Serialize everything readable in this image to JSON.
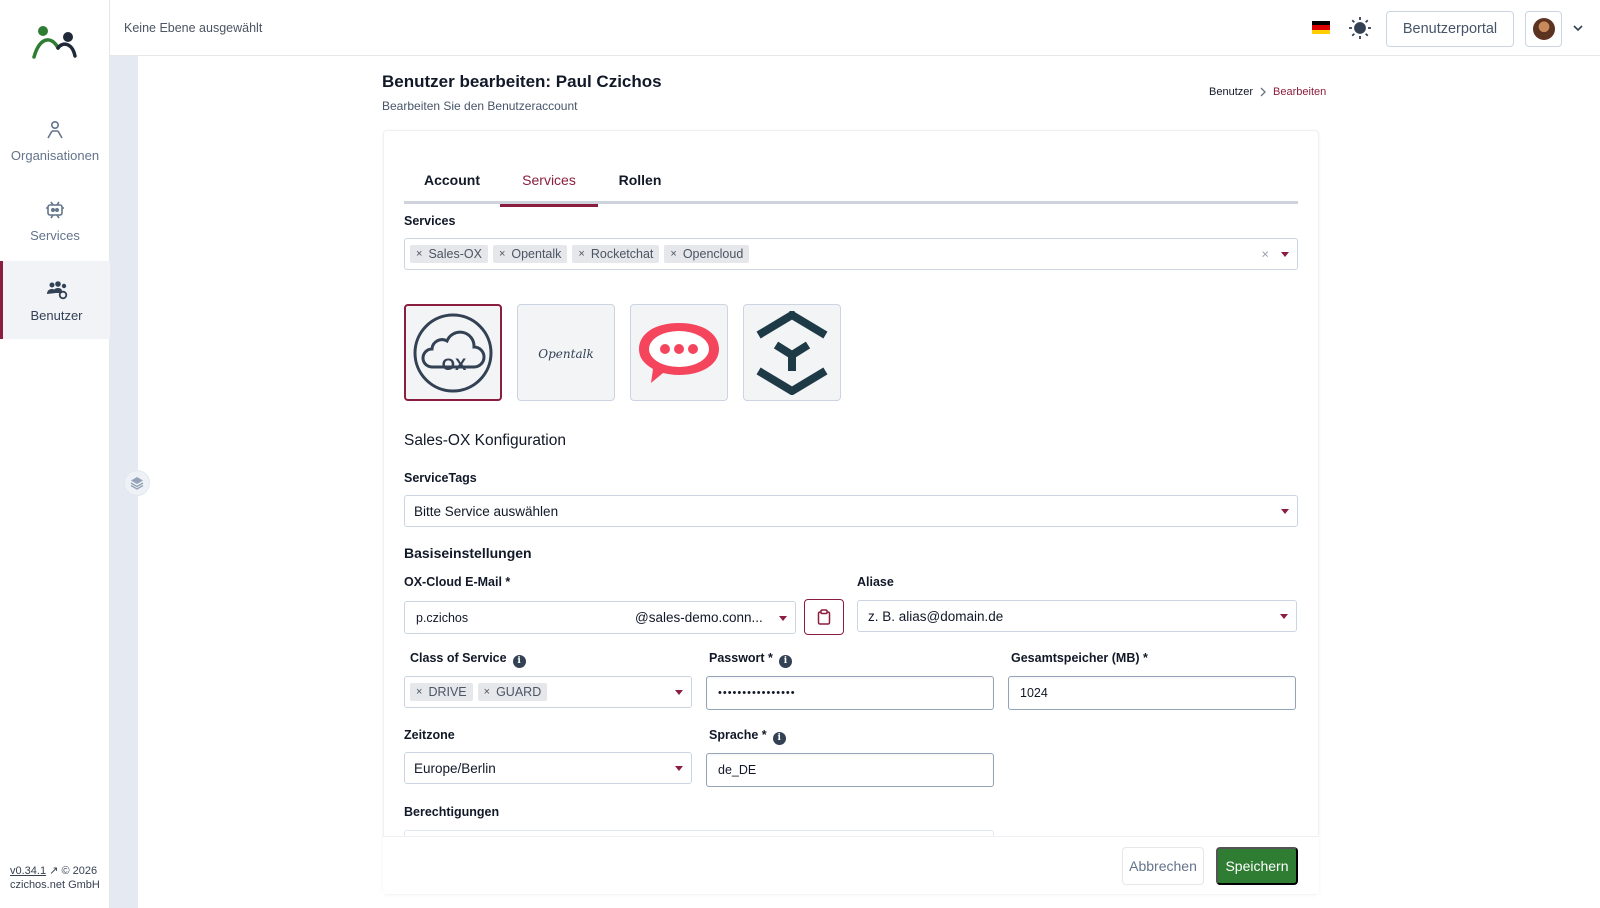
{
  "app": {
    "layer_text": "Keine Ebene ausgewählt"
  },
  "sidebar": {
    "items": [
      {
        "label": "Organisationen",
        "icon": "organization-icon"
      },
      {
        "label": "Services",
        "icon": "services-icon"
      },
      {
        "label": "Benutzer",
        "icon": "users-gear-icon"
      }
    ],
    "version": "v0.34.1",
    "copyright_year": "© 2026",
    "company": "czichos.net GmbH"
  },
  "topbar": {
    "portal_button": "Benutzerportal"
  },
  "header": {
    "title": "Benutzer bearbeiten: Paul Czichos",
    "subtitle": "Bearbeiten Sie den Benutzeraccount",
    "breadcrumb": [
      "Benutzer",
      "Bearbeiten"
    ]
  },
  "tabs": [
    {
      "label": "Account",
      "active": false
    },
    {
      "label": "Services",
      "active": true
    },
    {
      "label": "Rollen",
      "active": false
    }
  ],
  "services": {
    "label": "Services",
    "selected": [
      "Sales-OX",
      "Opentalk",
      "Rocketchat",
      "Opencloud"
    ],
    "tiles": [
      {
        "name": "ox-cloud-logo",
        "selected": true
      },
      {
        "name": "opentalk-logo",
        "text": "Opentalk",
        "selected": false
      },
      {
        "name": "rocketchat-logo",
        "selected": false
      },
      {
        "name": "opencloud-logo",
        "selected": false
      }
    ]
  },
  "config": {
    "title": "Sales-OX Konfiguration",
    "servicetags_label": "ServiceTags",
    "servicetags_placeholder": "Bitte Service auswählen",
    "basic_title": "Basiseinstellungen",
    "email_label": "OX-Cloud E-Mail *",
    "email_local": "p.czichos",
    "email_domain": "@sales-demo.conn...",
    "alias_label": "Aliase",
    "alias_placeholder": "z. B. alias@domain.de",
    "cos_label": "Class of Service",
    "cos_values": [
      "DRIVE",
      "GUARD"
    ],
    "password_label": "Passwort *",
    "password_value": "••••••••••••••••",
    "storage_label": "Gesamtspeicher (MB) *",
    "storage_value": "1024",
    "timezone_label": "Zeitzone",
    "timezone_value": "Europe/Berlin",
    "language_label": "Sprache *",
    "language_value": "de_DE",
    "permissions_label": "Berechtigungen"
  },
  "actions": {
    "cancel": "Abbrechen",
    "save": "Speichern"
  },
  "colors": {
    "accent": "#8b1e3f",
    "save": "#2e7d32",
    "brand_green": "#2e7d32"
  }
}
